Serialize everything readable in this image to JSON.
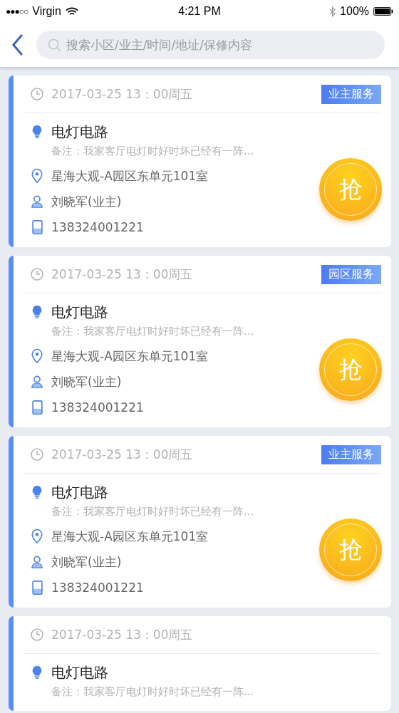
{
  "status_bar": {
    "signal_dots": "●●●○○",
    "carrier": "Virgin",
    "time": "4:21 PM",
    "battery": "100%"
  },
  "search": {
    "placeholder": "搜索小区/业主/时间/地址/保修内容"
  },
  "orders": [
    {
      "time": "2017-03-25 13：00周五",
      "tag": "业主服务",
      "title": "电灯电路",
      "note": "备注：我家客厅电灯时好时坏已经有一阵...",
      "address": "星海大观-A园区东单元101室",
      "contact": "刘晓军(业主)",
      "phone": "138324001221",
      "action": "抢"
    },
    {
      "time": "2017-03-25 13：00周五",
      "tag": "园区服务",
      "title": "电灯电路",
      "note": "备注：我家客厅电灯时好时坏已经有一阵...",
      "address": "星海大观-A园区东单元101室",
      "contact": "刘晓军(业主)",
      "phone": "138324001221",
      "action": "抢"
    },
    {
      "time": "2017-03-25 13：00周五",
      "tag": "业主服务",
      "title": "电灯电路",
      "note": "备注：我家客厅电灯时好时坏已经有一阵...",
      "address": "星海大观-A园区东单元101室",
      "contact": "刘晓军(业主)",
      "phone": "138324001221",
      "action": "抢"
    },
    {
      "time": "2017-03-25 13：00周五",
      "title": "电灯电路",
      "note": "备注：我家客厅电灯时好时坏已经有一阵..."
    }
  ]
}
